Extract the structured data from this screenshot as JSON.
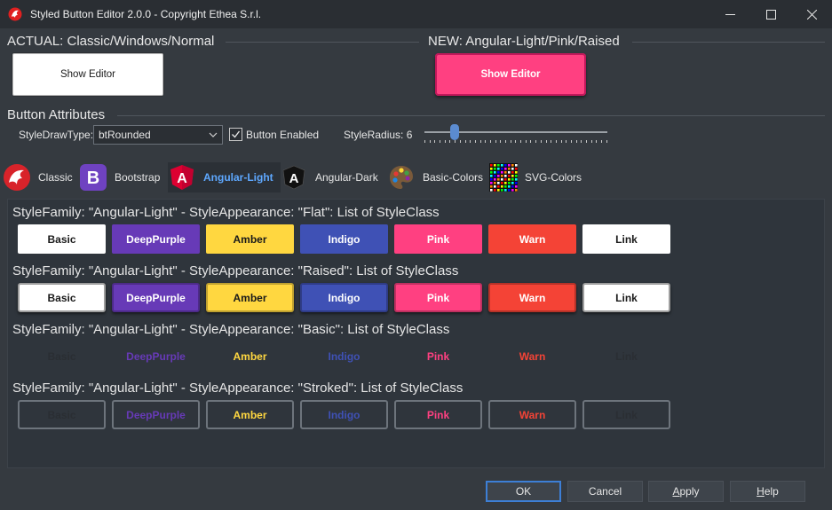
{
  "window": {
    "title": "Styled Button Editor 2.0.0 - Copyright Ethea S.r.l."
  },
  "actual": {
    "label": "ACTUAL: Classic/Windows/Normal",
    "button_label": "Show Editor"
  },
  "new": {
    "label": "NEW: Angular-Light/Pink/Raised",
    "button_label": "Show Editor"
  },
  "attributes": {
    "label": "Button Attributes",
    "draw_type_label": "StyleDrawType:",
    "draw_type_value": "btRounded",
    "enabled_label": "Button Enabled",
    "enabled_checked": true,
    "radius_label": "StyleRadius: 6",
    "radius_value": 6
  },
  "tabs": [
    {
      "label": "Classic",
      "icon": "classic-icon",
      "active": false
    },
    {
      "label": "Bootstrap",
      "icon": "bootstrap-icon",
      "active": false
    },
    {
      "label": "Angular-Light",
      "icon": "angular-light-icon",
      "active": true
    },
    {
      "label": "Angular-Dark",
      "icon": "angular-dark-icon",
      "active": false
    },
    {
      "label": "Basic-Colors",
      "icon": "palette-icon",
      "active": false
    },
    {
      "label": "SVG-Colors",
      "icon": "color-grid-icon",
      "active": false
    }
  ],
  "rows": [
    {
      "caption": "StyleFamily: \"Angular-Light\" - StyleAppearance: \"Flat\": List of StyleClass",
      "appearance": "flat"
    },
    {
      "caption": "StyleFamily: \"Angular-Light\" - StyleAppearance: \"Raised\": List of StyleClass",
      "appearance": "raised"
    },
    {
      "caption": "StyleFamily: \"Angular-Light\" - StyleAppearance: \"Basic\": List of StyleClass",
      "appearance": "basic"
    },
    {
      "caption": "StyleFamily: \"Angular-Light\" - StyleAppearance: \"Stroked\": List of StyleClass",
      "appearance": "stroked"
    }
  ],
  "style_classes": [
    {
      "label": "Basic",
      "bg": "#ffffff",
      "fg": "#1a1a1a",
      "text_color": "#2a2e33"
    },
    {
      "label": "DeepPurple",
      "bg": "#673ab7",
      "fg": "#ffffff",
      "text_color": "#673ab7"
    },
    {
      "label": "Amber",
      "bg": "#ffd740",
      "fg": "#1a1a1a",
      "text_color": "#ffd740"
    },
    {
      "label": "Indigo",
      "bg": "#3f51b5",
      "fg": "#ffffff",
      "text_color": "#3f51b5"
    },
    {
      "label": "Pink",
      "bg": "#ff4081",
      "fg": "#ffffff",
      "text_color": "#ff4081"
    },
    {
      "label": "Warn",
      "bg": "#f44336",
      "fg": "#ffffff",
      "text_color": "#f44336"
    },
    {
      "label": "Link",
      "bg": "#ffffff",
      "fg": "#1a1a1a",
      "text_color": "#2a2e33"
    }
  ],
  "dialog": {
    "ok": "OK",
    "cancel": "Cancel",
    "apply_first": "A",
    "apply_rest": "pply",
    "help_first": "H",
    "help_rest": "elp"
  }
}
